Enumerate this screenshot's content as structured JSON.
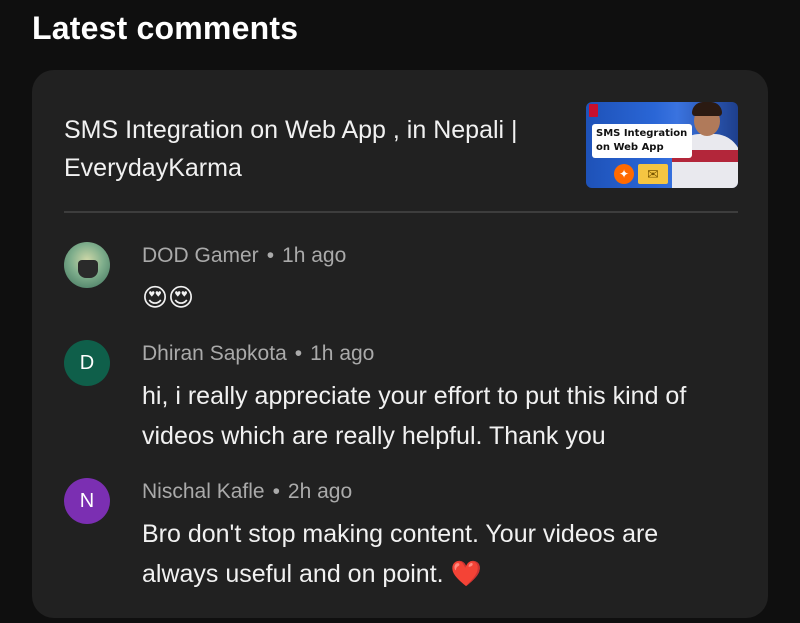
{
  "section": {
    "title": "Latest comments"
  },
  "video": {
    "title": "SMS Integration on Web App , in Nepali | EverydayKarma",
    "thumbnail_text": "SMS Integration on Web App"
  },
  "comments": [
    {
      "author": "DOD Gamer",
      "time": "1h ago",
      "text": "😍😍",
      "avatar_letter": "",
      "avatar_color": ""
    },
    {
      "author": "Dhiran Sapkota",
      "time": "1h ago",
      "text": "hi, i really appreciate your effort to put this kind of videos which are really helpful. Thank you",
      "avatar_letter": "D",
      "avatar_color": "#0f5f4a"
    },
    {
      "author": "Nischal Kafle",
      "time": "2h ago",
      "text": "Bro don't stop making content. Your videos are always useful and on point. ❤️",
      "avatar_letter": "N",
      "avatar_color": "#7b2fb2"
    }
  ],
  "separator": "•",
  "colors": {
    "background": "#0f0f0f",
    "card": "#212121",
    "meta_text": "#aaaaaa"
  }
}
